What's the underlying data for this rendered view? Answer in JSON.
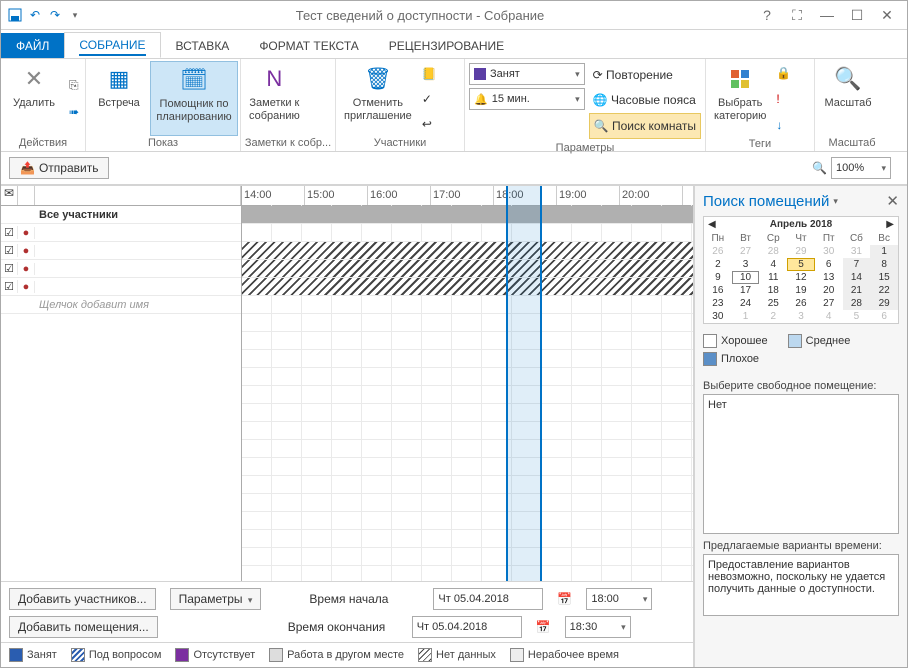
{
  "title": "Тест сведений о доступности - Собрание",
  "qat": {
    "save": "save",
    "undo": "undo",
    "redo": "redo"
  },
  "win": {
    "help": "?",
    "fullscreen": "⛶",
    "min": "—",
    "max": "☐",
    "close": "✕"
  },
  "tabs": {
    "file": "ФАЙЛ",
    "meeting": "СОБРАНИЕ",
    "insert": "ВСТАВКА",
    "format": "ФОРМАТ ТЕКСТА",
    "review": "РЕЦЕНЗИРОВАНИЕ"
  },
  "ribbon": {
    "actions": {
      "label": "Действия",
      "delete": "Удалить"
    },
    "show": {
      "label": "Показ",
      "appt": "Встреча",
      "sched": "Помощник по\nпланированию"
    },
    "notes": {
      "label": "Заметки к собр...",
      "btn": "Заметки к\nсобранию"
    },
    "attendees": {
      "label": "Участники",
      "cancel": "Отменить\nприглашение"
    },
    "options": {
      "label": "Параметры",
      "busy": "Занят",
      "reminder": "15 мин.",
      "recur": "Повторение",
      "tz": "Часовые пояса",
      "find": "Поиск комнаты"
    },
    "tags": {
      "label": "Теги",
      "cat": "Выбрать\nкатегорию"
    },
    "zoom": {
      "label": "Масштаб",
      "btn": "Масштаб"
    }
  },
  "toolbar": {
    "send": "Отправить",
    "zoom": "100%"
  },
  "attendees": {
    "all": "Все участники",
    "placeholder": "Щелчок добавит имя"
  },
  "timeline": {
    "hours": [
      "14:00",
      "15:00",
      "16:00",
      "17:00",
      "18:00",
      "19:00",
      "20:00"
    ]
  },
  "controls": {
    "addAtt": "Добавить участников...",
    "opts": "Параметры",
    "addRooms": "Добавить помещения...",
    "start": "Время начала",
    "end": "Время окончания",
    "startDate": "Чт 05.04.2018",
    "startTime": "18:00",
    "endDate": "Чт 05.04.2018",
    "endTime": "18:30"
  },
  "legend": {
    "busy": "Занят",
    "tentative": "Под вопросом",
    "oof": "Отсутствует",
    "elsewhere": "Работа в другом месте",
    "nodata": "Нет данных",
    "nonwork": "Нерабочее время"
  },
  "roomfinder": {
    "title": "Поиск помещений",
    "month": "Апрель 2018",
    "dow": [
      "Пн",
      "Вт",
      "Ср",
      "Чт",
      "Пт",
      "Сб",
      "Вс"
    ],
    "prev": [
      "26",
      "27",
      "28",
      "29",
      "30",
      "31"
    ],
    "days": [
      "1",
      "2",
      "3",
      "4",
      "5",
      "6",
      "7",
      "8",
      "9",
      "10",
      "11",
      "12",
      "13",
      "14",
      "15",
      "16",
      "17",
      "18",
      "19",
      "20",
      "21",
      "22",
      "23",
      "24",
      "25",
      "26",
      "27",
      "28",
      "29",
      "30"
    ],
    "next": [
      "1",
      "2",
      "3",
      "4",
      "5",
      "6"
    ],
    "good": "Хорошее",
    "fair": "Среднее",
    "poor": "Плохое",
    "choose": "Выберите свободное помещение:",
    "none": "Нет",
    "suggested": "Предлагаемые варианты времени:",
    "suggText": "Предоставление вариантов невозможно, поскольку не удается получить данные о доступности."
  }
}
